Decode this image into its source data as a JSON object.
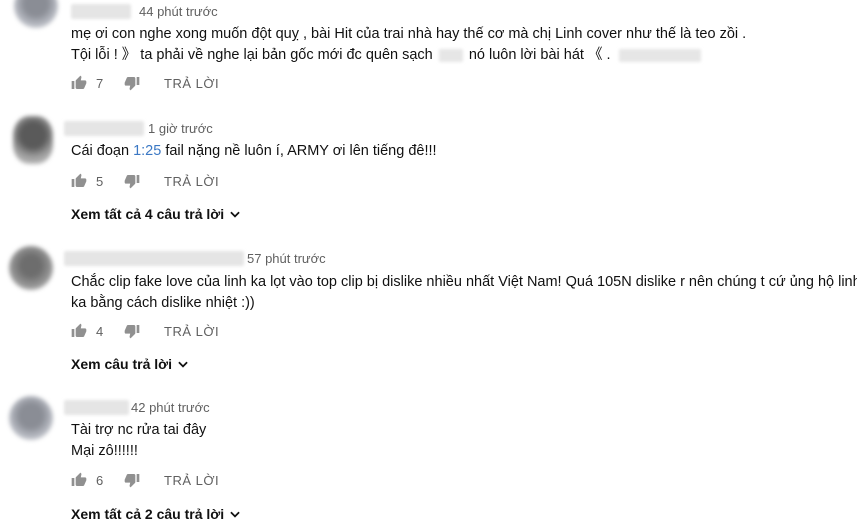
{
  "comments": [
    {
      "time": "44 phút trước",
      "lines": [
        "mẹ ơi con nghe xong muốn đột quỵ , bài Hit của trai nhà hay thế cơ mà chị Linh cover như thế là teo zồi .",
        "Tội lỗi ! 》 ta phải về nghe lại bản gốc mới đc quên sạch",
        "nó luôn lời bài hát 《 ."
      ],
      "likes": "7",
      "reply_label": "TRẢ LỜI"
    },
    {
      "time": "1 giờ trước",
      "text_before": "Cái đoạn ",
      "timestamp_link": "1:25",
      "text_after": " fail nặng nề luôn í, ARMY ơi lên tiếng đê!!!",
      "likes": "5",
      "reply_label": "TRẢ LỜI",
      "view_replies": "Xem tất cả 4 câu trả lời"
    },
    {
      "time": "57 phút trước",
      "lines": [
        "Chắc clip fake love của linh ka lọt vào top clip bị dislike nhiều nhất Việt Nam! Quá 105N dislike r nên chúng t cứ ủng hộ linh",
        "ka bằng cách dislike nhiệt :))"
      ],
      "likes": "4",
      "reply_label": "TRẢ LỜI",
      "view_replies": "Xem câu trả lời"
    },
    {
      "time": "42 phút trước",
      "lines": [
        "Tài trợ nc rửa tai đây",
        "Mại zô!!!!!!"
      ],
      "likes": "6",
      "reply_label": "TRẢ LỜI",
      "view_replies": "Xem tất cả 2 câu trả lời"
    }
  ]
}
